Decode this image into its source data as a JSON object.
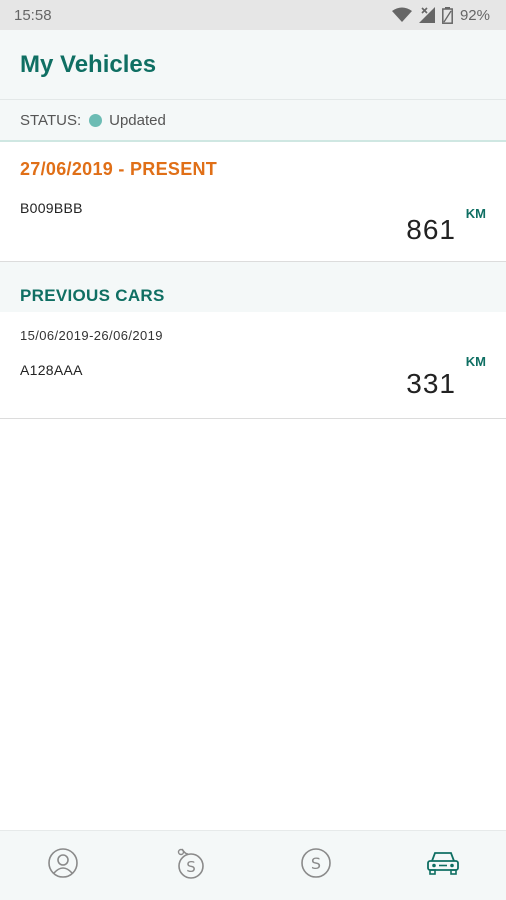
{
  "status_bar": {
    "time": "15:58",
    "battery": "92%",
    "icons": [
      "wifi-icon",
      "signal-icon",
      "battery-icon"
    ]
  },
  "header": {
    "title": "My Vehicles"
  },
  "sync_status": {
    "label": "STATUS:",
    "value": "Updated",
    "dot_color": "#6cbcb4"
  },
  "current_vehicle": {
    "period": "27/06/2019 - PRESENT",
    "plate": "B009BBB",
    "distance": "861",
    "unit": "KM"
  },
  "previous_section": {
    "title": "PREVIOUS CARS",
    "items": [
      {
        "period": "15/06/2019-26/06/2019",
        "plate": "A128AAA",
        "distance": "331",
        "unit": "KM"
      }
    ]
  },
  "bottom_nav": {
    "items": [
      {
        "icon": "profile-icon"
      },
      {
        "icon": "savings-icon"
      },
      {
        "icon": "money-icon"
      },
      {
        "icon": "car-icon",
        "active": true
      }
    ]
  },
  "colors": {
    "brand": "#0f6f63",
    "accent_orange": "#e06f17",
    "inactive_icon": "#8a8a8a"
  }
}
